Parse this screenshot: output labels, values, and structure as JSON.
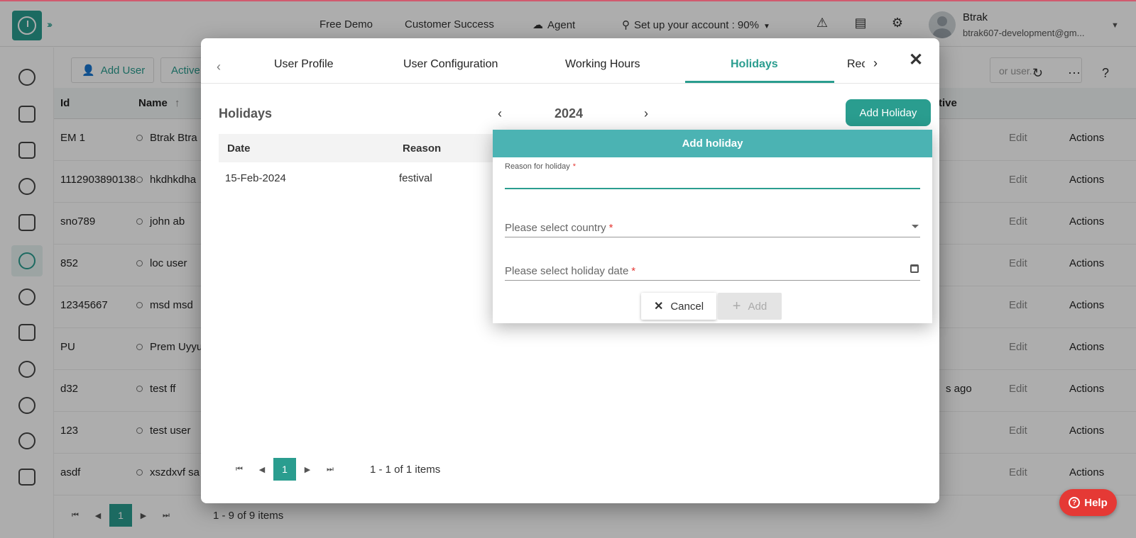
{
  "topbar": {
    "free_demo": "Free Demo",
    "customer_success": "Customer Success",
    "agent": "Agent",
    "setup": "Set up your account : 90%",
    "user_name": "Btrak",
    "user_email": "btrak607-development@gm..."
  },
  "toolbar": {
    "add_user": "Add User",
    "active": "Active",
    "search_placeholder": "or user.."
  },
  "grid": {
    "headers": {
      "id": "Id",
      "name": "Name",
      "extra": "tive"
    },
    "rows": [
      {
        "id": "EM 1",
        "name": "Btrak Btra",
        "extra": "",
        "edit": "Edit",
        "actions": "Actions"
      },
      {
        "id": "1112903890138",
        "name": "hkdhkdha",
        "extra": "",
        "edit": "Edit",
        "actions": "Actions"
      },
      {
        "id": "sno789",
        "name": "john ab",
        "extra": "",
        "edit": "Edit",
        "actions": "Actions"
      },
      {
        "id": "852",
        "name": "loc user",
        "extra": "",
        "edit": "Edit",
        "actions": "Actions"
      },
      {
        "id": "12345667",
        "name": "msd msd",
        "extra": "",
        "edit": "Edit",
        "actions": "Actions"
      },
      {
        "id": "PU",
        "name": "Prem Uyyu",
        "extra": "",
        "edit": "Edit",
        "actions": "Actions"
      },
      {
        "id": "d32",
        "name": "test ff",
        "extra": "s ago",
        "edit": "Edit",
        "actions": "Actions"
      },
      {
        "id": "123",
        "name": "test user",
        "extra": "",
        "edit": "Edit",
        "actions": "Actions"
      },
      {
        "id": "asdf",
        "name": "xszdxvf sa",
        "extra": "",
        "edit": "Edit",
        "actions": "Actions"
      }
    ],
    "pager": {
      "page": "1",
      "info": "1 - 9 of 9 items"
    }
  },
  "modal": {
    "tabs": [
      "User Profile",
      "User Configuration",
      "Working Hours",
      "Holidays",
      "Rec"
    ],
    "active_tab": "Holidays",
    "section_title": "Holidays",
    "year": "2024",
    "add_holiday": "Add Holiday",
    "table": {
      "headers": {
        "date": "Date",
        "reason": "Reason"
      },
      "rows": [
        {
          "date": "15-Feb-2024",
          "reason": "festival"
        }
      ]
    },
    "pager": {
      "page": "1",
      "info": "1 - 1 of 1 items"
    }
  },
  "dialog": {
    "title": "Add holiday",
    "reason_label": "Reason for holiday",
    "reason_value": "",
    "country_placeholder": "Please select country",
    "date_placeholder": "Please select holiday date",
    "required_mark": "*",
    "cancel": "Cancel",
    "add": "Add"
  },
  "help": {
    "label": "Help"
  },
  "colors": {
    "accent": "#2a9d8f",
    "dialog_header": "#4bb3b3",
    "help": "#e53935"
  }
}
